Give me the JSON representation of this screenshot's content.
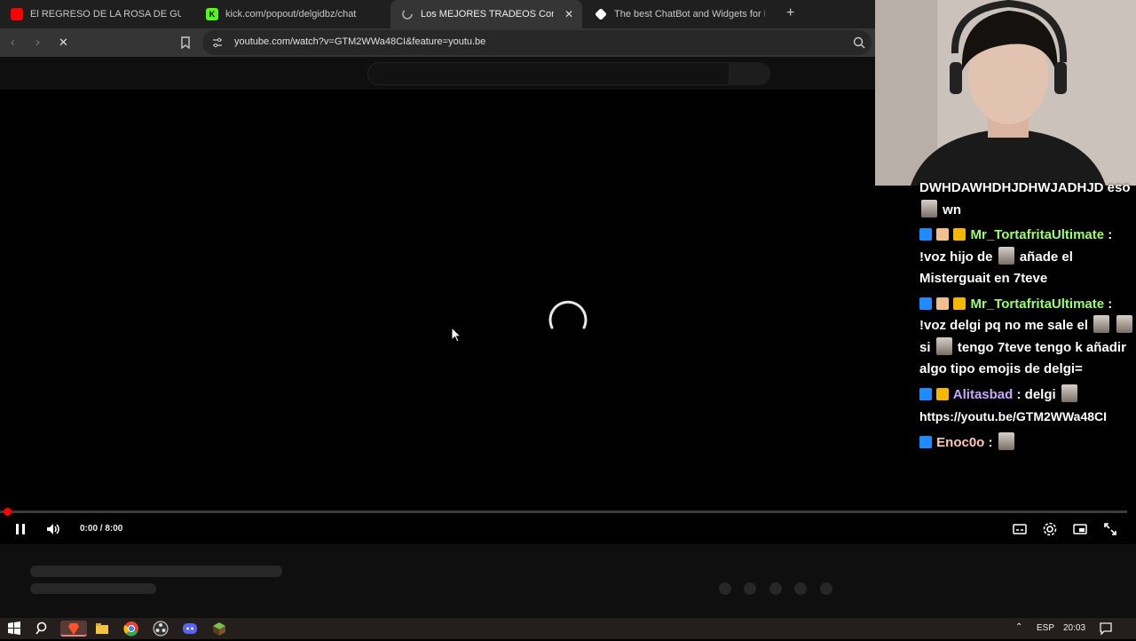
{
  "browser": {
    "tabs": [
      {
        "title": "El REGRESO DE LA ROSA DE GUADA",
        "favicon": "youtube-icon",
        "color": "#ff0000",
        "active": false
      },
      {
        "title": "kick.com/popout/delgidbz/chat",
        "favicon": "kick-icon",
        "color": "#53fc18",
        "active": false
      },
      {
        "title": "Los MEJORES TRADEOS Con Cad",
        "favicon": "loading-icon",
        "color": "#aaaaaa",
        "active": true
      },
      {
        "title": "The best ChatBot and Widgets for Ki",
        "favicon": "botrix-icon",
        "color": "#ffffff",
        "active": false
      }
    ],
    "new_tab_label": "+",
    "url": "youtube.com/watch?v=GTM2WWa48CI&feature=youtu.be"
  },
  "player": {
    "timecode": "0:00 / 8:00",
    "progress_fraction": 0.0,
    "state": "loading",
    "accent_color": "#ff0000"
  },
  "chat": {
    "messages": [
      {
        "user": "",
        "user_color": "#ffffff",
        "badges": [],
        "text": "DWHDAWHDHJDHWJADHJD eso",
        "suffix": "wn"
      },
      {
        "user": "Mr_TortafritaUltimate",
        "user_color": "#9cff6a",
        "badges": [
          "verified",
          "wave",
          "crown"
        ],
        "text": "!voz hijo de",
        "suffix": "añade el Misterguait en 7teve"
      },
      {
        "user": "Mr_TortafritaUltimate",
        "user_color": "#9cff6a",
        "badges": [
          "verified",
          "wave",
          "crown"
        ],
        "text": "!voz delgi pq no me sale el",
        "suffix": "si",
        "suffix2": "tengo 7teve tengo k añadir algo tipo emojis de delgi="
      },
      {
        "user": "Alitasbad",
        "user_color": "#c9a4ff",
        "badges": [
          "verified",
          "crown"
        ],
        "text": "delgi",
        "suffix": "https://youtu.be/GTM2WWa48CI"
      },
      {
        "user": "Enoc0o",
        "user_color": "#ffc6b8",
        "badges": [
          "verified"
        ],
        "text": "",
        "suffix": ""
      }
    ]
  },
  "taskbar": {
    "language": "ESP",
    "time": "20:03"
  }
}
